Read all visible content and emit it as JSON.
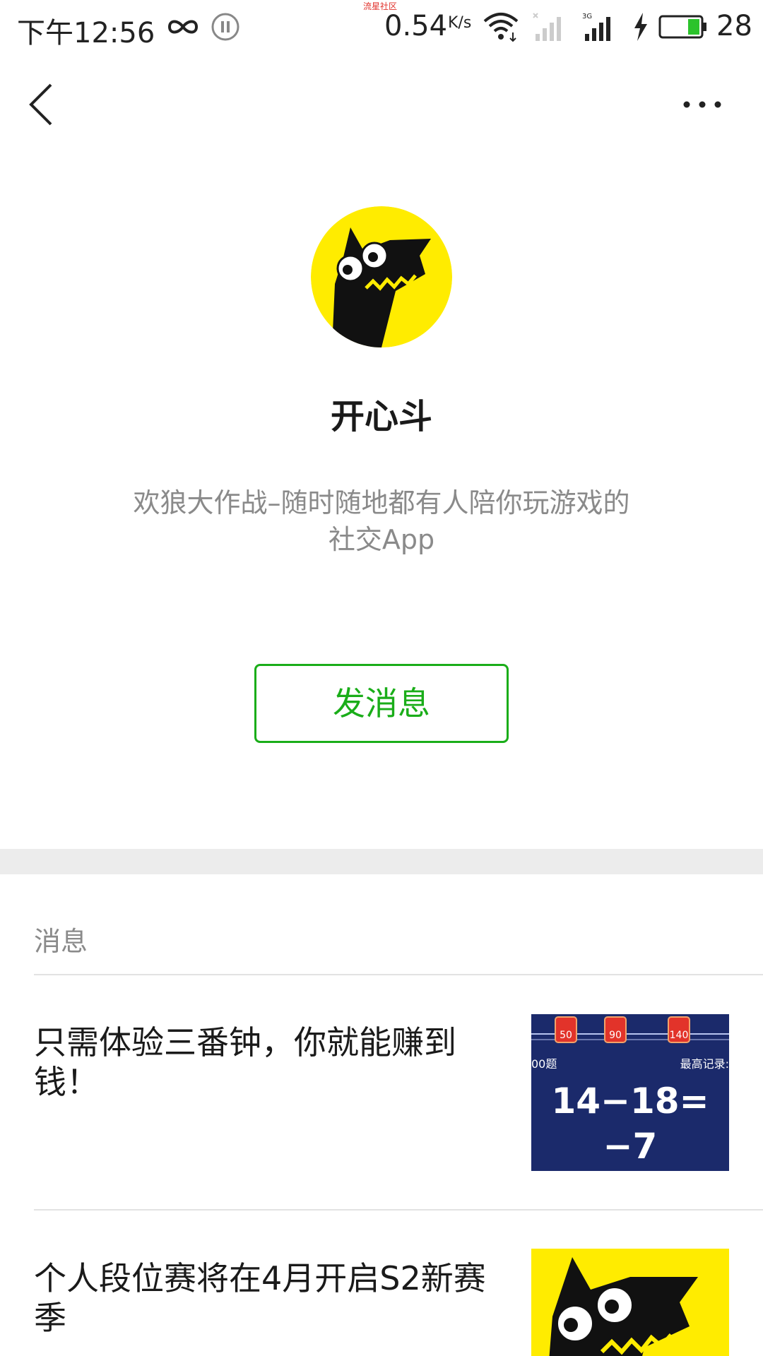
{
  "status_bar": {
    "time": "下午12:56",
    "watermark": "流星社区",
    "speed": "0.54",
    "speed_unit": "K/s",
    "battery_level": "28",
    "icons": [
      "infinity-icon",
      "pause-icon",
      "wifi-icon",
      "signal-icon",
      "signal-3g-icon",
      "charging-icon",
      "battery-icon"
    ]
  },
  "nav": {
    "back_icon": "back-chevron-icon",
    "more_icon": "more-dots-icon"
  },
  "profile": {
    "name": "开心斗",
    "description": "欢狼大作战–随时随地都有人陪你玩游戏的社交App",
    "send_button_label": "发消息"
  },
  "messages_section": {
    "label": "消息",
    "items": [
      {
        "title": "只需体验三番钟，你就能赚到钱！",
        "thumb": {
          "badges": [
            "50",
            "90",
            "140"
          ],
          "left_text": "00题",
          "right_text": "最高记录:",
          "equation": "14−18=",
          "answer": "−7"
        }
      },
      {
        "title": "个人段位赛将在4月开启S2新赛季",
        "thumb": {
          "icon": "wolf-logo-icon"
        }
      }
    ]
  },
  "colors": {
    "accent_green": "#1aad19",
    "avatar_yellow": "#ffec00",
    "thumb_navy": "#1b2a6b"
  }
}
